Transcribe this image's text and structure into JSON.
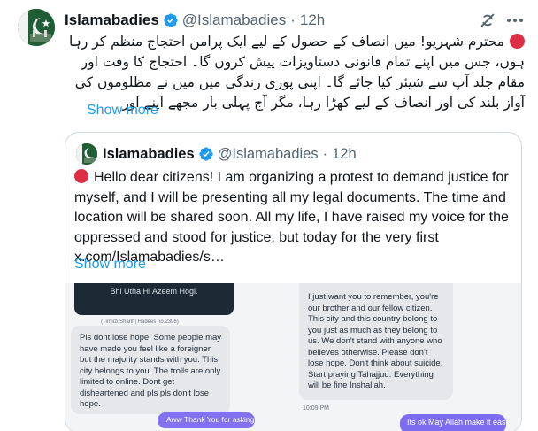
{
  "tweet": {
    "name": "Islamabadies",
    "handle": "@Islamabadies",
    "separator": "·",
    "time": "12h",
    "text_urdu": "محترم شہریو! میں انصاف کے حصول کے لیے ایک پرامن احتجاج منظم کر رہا ہوں، جس میں اپنے تمام قانونی دستاویزات پیش کروں گا۔ احتجاج کا وقت اور مقام جلد آپ سے شیئر کیا جائے گا۔ اپنی پوری زندگی میں میں نے مظلوموں کی آواز بلند کی اور انصاف کے لیے کھڑا رہا، مگر آج پہلی بار مجھے اپنے اور",
    "show_more": "Show more"
  },
  "quote": {
    "name": "Islamabadies",
    "handle": "@Islamabadies",
    "separator": "·",
    "time": "12h",
    "text": "Hello dear citizens! I am organizing a protest to demand justice for myself, and I will be presenting all my legal documents. The time and location will be shared soon. All my life, I have raised my voice for the oppressed and stood for justice, but today for the very first x.com/Islamabadies/s…",
    "show_more": "Show more"
  },
  "media": {
    "left": {
      "dark_card_text": "Bhi Utha Hi Azeem Hogi.",
      "caption": "(Tirmizi Sharif | Hadees no.2396)",
      "bubble_text": "Pls dont lose hope. Some people may have made you feel like a foreigner but the majority stands with you. This city belongs to you. The trolls are only limited to online. Dont get disheartened and pls pls don't lose hope.",
      "reply_bubble": "Aww Thank You for asking"
    },
    "right": {
      "bubble_text": "I just want you to remember, you're our brother and our fellow citizen. This city and this country belong to you just as much as they belong to us. We don't stand with anyone who believes otherwise. Please don't lose hope. Don't think about suicide. Start praying Tahajjud. Everything will be fine Inshallah.",
      "chat_time": "10:09 PM",
      "reply_bubble": "Its ok May Allah make it easy for"
    }
  },
  "colors": {
    "accent": "#1d9bf0",
    "verified": "#1d9bf0",
    "red_circle": "#dd2e44",
    "secondary_text": "#536471",
    "chat_bubble_purple": "#7c6cf0"
  },
  "icons": {
    "verified": "verified-badge-icon",
    "grok": "grok-icon",
    "more": "more-options-icon",
    "red_circle": "red-circle-emoji-icon"
  }
}
